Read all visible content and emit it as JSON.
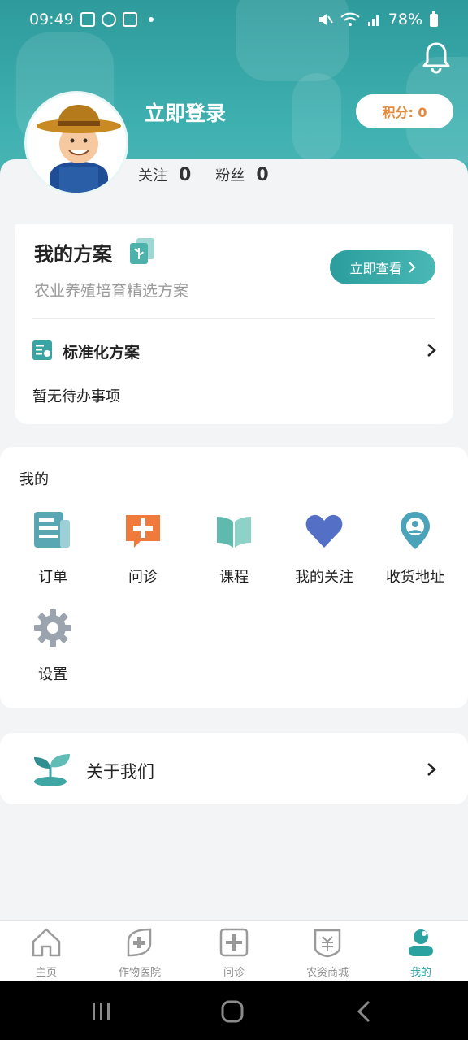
{
  "status": {
    "time": "09:49",
    "battery": "78%"
  },
  "profile": {
    "login_label": "立即登录",
    "points_label": "积分: 0",
    "follow_label": "关注",
    "follow_count": "0",
    "fans_label": "粉丝",
    "fans_count": "0"
  },
  "plan": {
    "title": "我的方案",
    "subtitle": "农业养殖培育精选方案",
    "view_button": "立即查看",
    "standard_label": "标准化方案",
    "todo_text": "暂无待办事项"
  },
  "mine": {
    "title": "我的",
    "items": [
      {
        "label": "订单",
        "icon": "order-icon",
        "color": "#5aa7b4"
      },
      {
        "label": "问诊",
        "icon": "consult-icon",
        "color": "#f07a3c"
      },
      {
        "label": "课程",
        "icon": "book-icon",
        "color": "#5fb9ad"
      },
      {
        "label": "我的关注",
        "icon": "heart-icon",
        "color": "#5470c6"
      },
      {
        "label": "收货地址",
        "icon": "location-icon",
        "color": "#4aa3b8"
      },
      {
        "label": "设置",
        "icon": "gear-icon",
        "color": "#9aa3ae"
      }
    ]
  },
  "about": {
    "label": "关于我们"
  },
  "tabs": [
    {
      "label": "主页",
      "icon": "home-icon"
    },
    {
      "label": "作物医院",
      "icon": "crop-hospital-icon"
    },
    {
      "label": "问诊",
      "icon": "consult-tab-icon"
    },
    {
      "label": "农资商城",
      "icon": "mall-icon"
    },
    {
      "label": "我的",
      "icon": "profile-icon",
      "active": true
    }
  ],
  "theme": {
    "accent": "#2aa3a0",
    "points_color": "#e68a3a"
  }
}
